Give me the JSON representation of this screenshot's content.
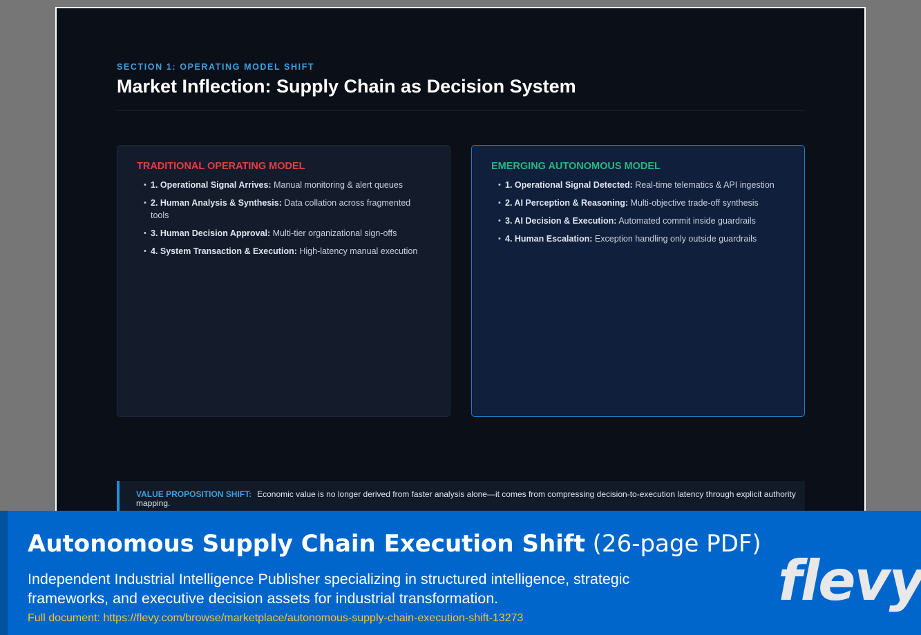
{
  "slide": {
    "section_label": "SECTION 1: OPERATING MODEL SHIFT",
    "title": "Market Inflection: Supply Chain as Decision System",
    "traditional": {
      "title": "TRADITIONAL OPERATING MODEL",
      "steps": [
        {
          "label": "1. Operational Signal Arrives:",
          "text": "Manual monitoring & alert queues"
        },
        {
          "label": "2. Human Analysis & Synthesis:",
          "text": "Data collation across fragmented tools"
        },
        {
          "label": "3. Human Decision Approval:",
          "text": "Multi-tier organizational sign-offs"
        },
        {
          "label": "4. System Transaction & Execution:",
          "text": "High-latency manual execution"
        }
      ]
    },
    "autonomous": {
      "title": "EMERGING AUTONOMOUS MODEL",
      "steps": [
        {
          "label": "1. Operational Signal Detected:",
          "text": "Real-time telematics & API ingestion"
        },
        {
          "label": "2. AI Perception & Reasoning:",
          "text": "Multi-objective trade-off synthesis"
        },
        {
          "label": "3. AI Decision & Execution:",
          "text": "Automated commit inside guardrails"
        },
        {
          "label": "4. Human Escalation:",
          "text": "Exception handling only outside guardrails"
        }
      ]
    },
    "value_box": {
      "label": "VALUE PROPOSITION SHIFT:",
      "text": "Economic value is no longer derived from faster analysis alone—it comes from compressing decision-to-execution latency through explicit authority mapping."
    }
  },
  "banner": {
    "title_bold": "Autonomous Supply Chain Execution Shift",
    "title_suffix": "(26-page PDF)",
    "description": "Independent Industrial Intelligence Publisher specializing in structured intelligence, strategic frameworks, and executive decision assets for industrial transformation.",
    "link": "Full document: https://flevy.com/browse/marketplace/autonomous-supply-chain-execution-shift-13273",
    "logo": "flevy"
  },
  "colors": {
    "background": "#767676",
    "slide_bg": "#0b0f17",
    "accent_blue": "#3ea0e0",
    "traditional_red": "#e0403f",
    "autonomous_green": "#2bb580",
    "banner_blue": "#0066cc",
    "link_yellow": "#f4c430"
  }
}
